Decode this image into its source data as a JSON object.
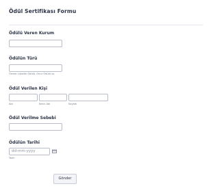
{
  "form": {
    "title": "Ödül Sertifikası Formu",
    "fields": {
      "awarding_org": {
        "label": "Ödülü Veren Kurum"
      },
      "award_type": {
        "label": "Ödülün Türü",
        "hint": "Örnek: Liderlik Ödülü, Onur Ödülü vs."
      },
      "recipient": {
        "label": "Ödül Verilen Kişi",
        "sublabels": {
          "first": "Adı",
          "middle": "İkinci Adı",
          "last": "Soyadı"
        }
      },
      "reason": {
        "label": "Ödül Verilme Sebebi"
      },
      "award_date": {
        "label": "Ödülün Tarihi",
        "placeholder": "dd-mm-yyyy",
        "sublabel": "Tarih"
      }
    },
    "submit_label": "Gönder"
  },
  "icons": {
    "date_picker": "calendar-icon"
  },
  "colors": {
    "text": "#2c3345",
    "border": "#b8bdc9",
    "divider": "#e6e7ee"
  }
}
